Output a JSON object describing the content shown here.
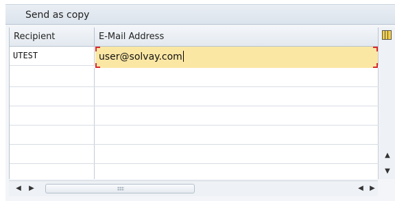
{
  "dialog": {
    "title": "Send as copy"
  },
  "table": {
    "columns": [
      "Recipient",
      "E-Mail Address"
    ],
    "rows": [
      {
        "recipient": "UTEST",
        "email": "user@solvay.com"
      }
    ]
  },
  "icons": {
    "layout": "table-layout-icon",
    "scroll_up": "arrow-up-icon",
    "scroll_down": "arrow-down-icon",
    "scroll_left": "arrow-left-icon",
    "scroll_right": "arrow-right-icon"
  },
  "colors": {
    "active_cell": "#fbe7a4",
    "required_marker": "#d9272e",
    "header": "#e3e9f0"
  }
}
